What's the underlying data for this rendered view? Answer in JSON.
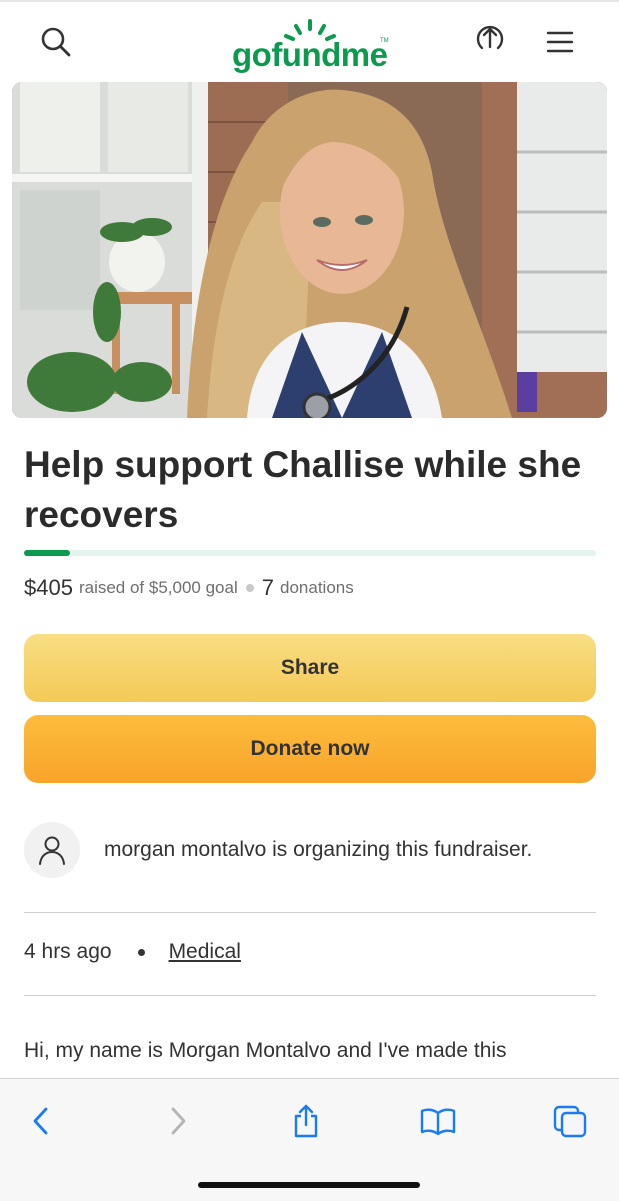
{
  "header": {
    "logo_text": "gofundme",
    "logo_tm": "TM",
    "icons": [
      "search-icon",
      "upload-icon",
      "menu-icon"
    ]
  },
  "campaign": {
    "title": "Help support Challise while she recovers",
    "raised": "$405",
    "goal_text": "raised of $5,000 goal",
    "donations_count": "7",
    "donations_label": "donations",
    "progress_fraction": 0.081
  },
  "buttons": {
    "share": "Share",
    "donate": "Donate now"
  },
  "organizer": {
    "text": "morgan montalvo is organizing this fundraiser."
  },
  "meta": {
    "time": "4 hrs ago",
    "category": "Medical"
  },
  "story": {
    "line1": "Hi, my name is Morgan Montalvo and I've made this"
  },
  "toolbar": {
    "icons": [
      "back-icon",
      "forward-icon",
      "share-icon",
      "bookmarks-icon",
      "tabs-icon"
    ]
  },
  "colors": {
    "brand_green": "#0c9a4e",
    "share_button": "#f6d36d",
    "donate_button": "#fbb033",
    "safari_blue": "#1a7cf4"
  }
}
